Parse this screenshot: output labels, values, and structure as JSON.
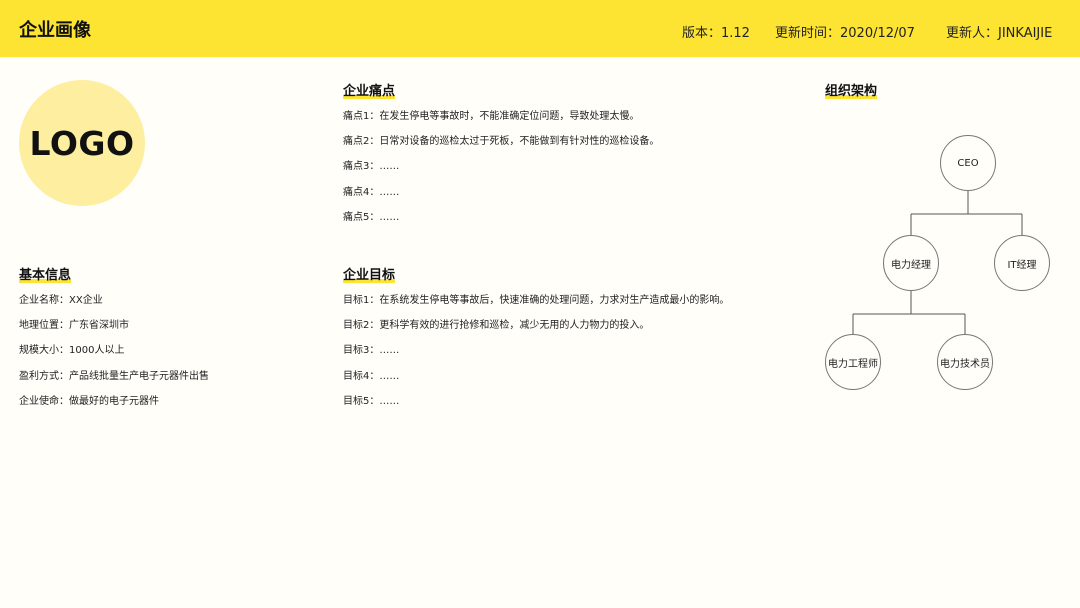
{
  "header": {
    "title": "企业画像",
    "version": "版本：1.12",
    "updated_time": "更新时间：2020/12/07",
    "updated_by": "更新人：JINKAIJIE"
  },
  "logo": {
    "text": "LOGO"
  },
  "basic_info": {
    "title": "基本信息",
    "items": [
      "企业名称：XX企业",
      "地理位置：广东省深圳市",
      "规模大小：1000人以上",
      "盈利方式：产品线批量生产电子元器件出售",
      "企业使命：做最好的电子元器件"
    ]
  },
  "pain_points": {
    "title": "企业痛点",
    "items": [
      "痛点1：在发生停电等事故时，不能准确定位问题，导致处理太慢。",
      "痛点2：日常对设备的巡检太过于死板，不能做到有针对性的巡检设备。",
      "痛点3：……",
      "痛点4：……",
      "痛点5：……"
    ]
  },
  "goals": {
    "title": "企业目标",
    "items": [
      "目标1：在系统发生停电等事故后，快速准确的处理问题，力求对生产造成最小的影响。",
      "目标2：更科学有效的进行抢修和巡检，减少无用的人力物力的投入。",
      "目标3：……",
      "目标4：……",
      "目标5：……"
    ]
  },
  "org_chart": {
    "title": "组织架构",
    "nodes": {
      "ceo": "CEO",
      "power_manager": "电力经理",
      "it_manager": "IT经理",
      "power_engineer": "电力工程师",
      "power_technician": "电力技术员"
    }
  },
  "colors": {
    "accent": "#fde433",
    "logo_bg": "#fdeea0",
    "background": "#fffef9"
  }
}
